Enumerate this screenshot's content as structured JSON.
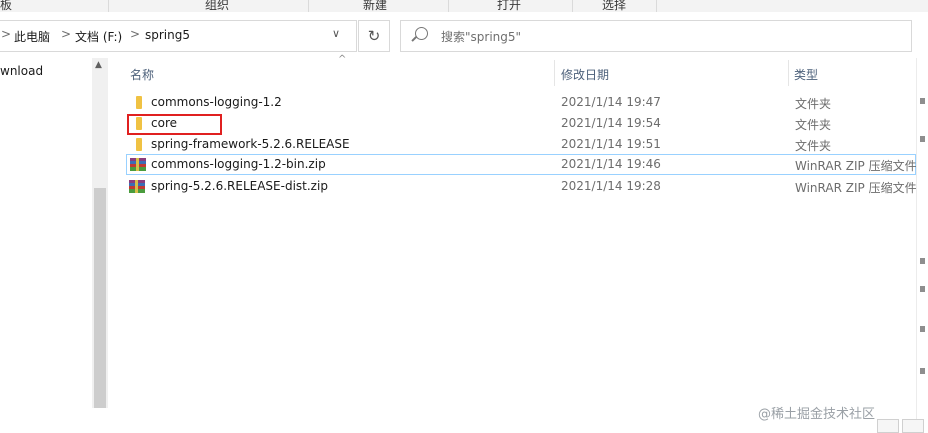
{
  "ribbon": {
    "groups": [
      "板",
      "组织",
      "新建",
      "打开",
      "选择"
    ]
  },
  "address": {
    "crumbs": [
      "此电脑",
      "文档 (F:)",
      "spring5"
    ],
    "chevron": ">",
    "dropdown": "∨",
    "refresh": "↻"
  },
  "search": {
    "placeholder": "搜索\"spring5\""
  },
  "nav": {
    "items": [
      "wnload"
    ],
    "scroll_up": "▲"
  },
  "columns": {
    "name": "名称",
    "date": "修改日期",
    "type": "类型",
    "sort_indicator": "^"
  },
  "files": [
    {
      "name": "commons-logging-1.2",
      "date": "2021/1/14 19:47",
      "type": "文件夹",
      "icon": "folder-icon"
    },
    {
      "name": "core",
      "date": "2021/1/14 19:54",
      "type": "文件夹",
      "icon": "folder-icon",
      "highlighted": true
    },
    {
      "name": "spring-framework-5.2.6.RELEASE",
      "date": "2021/1/14 19:51",
      "type": "文件夹",
      "icon": "folder-icon"
    },
    {
      "name": "commons-logging-1.2-bin.zip",
      "date": "2021/1/14 19:46",
      "type": "WinRAR ZIP 压缩文件",
      "icon": "winrar-zip-icon",
      "selected": true
    },
    {
      "name": "spring-5.2.6.RELEASE-dist.zip",
      "date": "2021/1/14 19:28",
      "type": "WinRAR ZIP 压缩文件",
      "icon": "winrar-zip-icon"
    }
  ],
  "credit": "@稀土掘金技术社区",
  "colors": {
    "highlight_border": "#e02020",
    "selection_border": "#99d1ff",
    "folder": "#f0c243",
    "header_text": "#4c607a"
  }
}
